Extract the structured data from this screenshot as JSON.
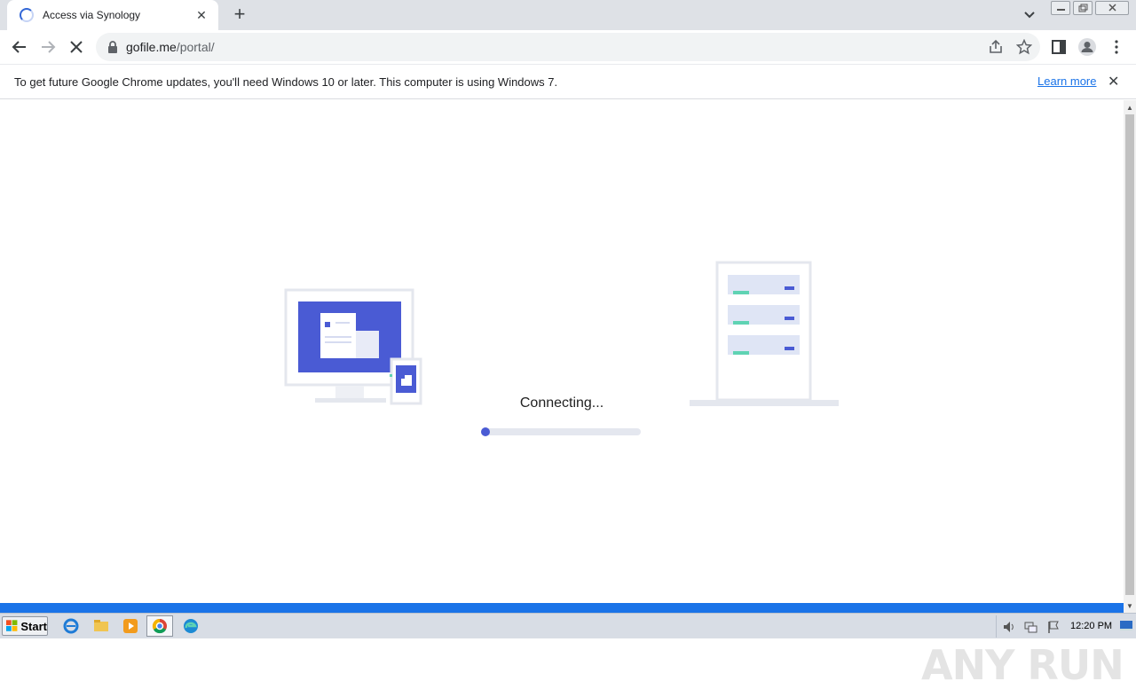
{
  "browser": {
    "tab": {
      "title": "Access via Synology",
      "loading": true
    },
    "url": {
      "host": "gofile.me",
      "path": "/portal/"
    },
    "infobar": {
      "message": "To get future Google Chrome updates, you'll need Windows 10 or later. This computer is using Windows 7.",
      "link": "Learn more"
    }
  },
  "page": {
    "status": "Connecting...",
    "progress": 0.05,
    "colors": {
      "accent": "#4a5bd4",
      "server_light": "#dfe5f5",
      "indicator": "#5fd3b3"
    }
  },
  "watermark": "ANY RUN",
  "taskbar": {
    "start_label": "Start",
    "clock": "12:20 PM"
  }
}
